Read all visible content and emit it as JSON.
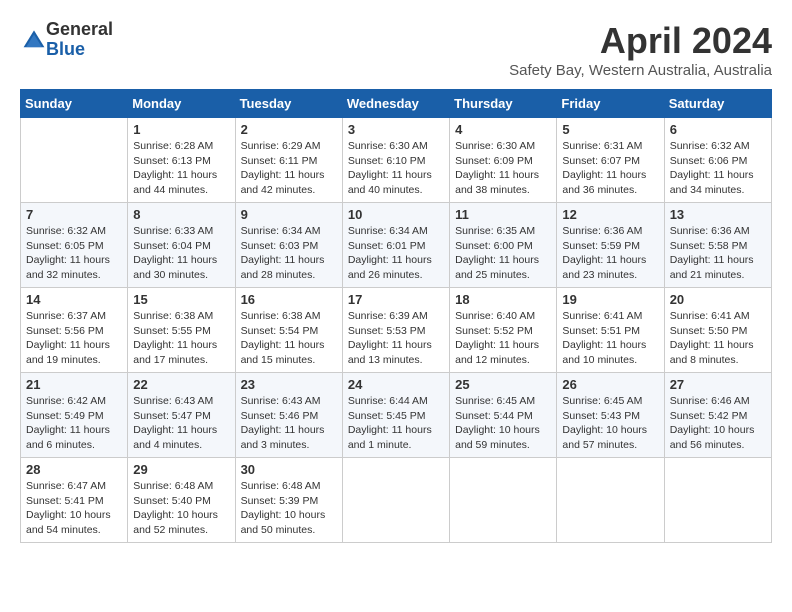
{
  "logo": {
    "general": "General",
    "blue": "Blue"
  },
  "header": {
    "month": "April 2024",
    "location": "Safety Bay, Western Australia, Australia"
  },
  "weekdays": [
    "Sunday",
    "Monday",
    "Tuesday",
    "Wednesday",
    "Thursday",
    "Friday",
    "Saturday"
  ],
  "weeks": [
    [
      {
        "day": "",
        "info": ""
      },
      {
        "day": "1",
        "info": "Sunrise: 6:28 AM\nSunset: 6:13 PM\nDaylight: 11 hours\nand 44 minutes."
      },
      {
        "day": "2",
        "info": "Sunrise: 6:29 AM\nSunset: 6:11 PM\nDaylight: 11 hours\nand 42 minutes."
      },
      {
        "day": "3",
        "info": "Sunrise: 6:30 AM\nSunset: 6:10 PM\nDaylight: 11 hours\nand 40 minutes."
      },
      {
        "day": "4",
        "info": "Sunrise: 6:30 AM\nSunset: 6:09 PM\nDaylight: 11 hours\nand 38 minutes."
      },
      {
        "day": "5",
        "info": "Sunrise: 6:31 AM\nSunset: 6:07 PM\nDaylight: 11 hours\nand 36 minutes."
      },
      {
        "day": "6",
        "info": "Sunrise: 6:32 AM\nSunset: 6:06 PM\nDaylight: 11 hours\nand 34 minutes."
      }
    ],
    [
      {
        "day": "7",
        "info": "Sunrise: 6:32 AM\nSunset: 6:05 PM\nDaylight: 11 hours\nand 32 minutes."
      },
      {
        "day": "8",
        "info": "Sunrise: 6:33 AM\nSunset: 6:04 PM\nDaylight: 11 hours\nand 30 minutes."
      },
      {
        "day": "9",
        "info": "Sunrise: 6:34 AM\nSunset: 6:03 PM\nDaylight: 11 hours\nand 28 minutes."
      },
      {
        "day": "10",
        "info": "Sunrise: 6:34 AM\nSunset: 6:01 PM\nDaylight: 11 hours\nand 26 minutes."
      },
      {
        "day": "11",
        "info": "Sunrise: 6:35 AM\nSunset: 6:00 PM\nDaylight: 11 hours\nand 25 minutes."
      },
      {
        "day": "12",
        "info": "Sunrise: 6:36 AM\nSunset: 5:59 PM\nDaylight: 11 hours\nand 23 minutes."
      },
      {
        "day": "13",
        "info": "Sunrise: 6:36 AM\nSunset: 5:58 PM\nDaylight: 11 hours\nand 21 minutes."
      }
    ],
    [
      {
        "day": "14",
        "info": "Sunrise: 6:37 AM\nSunset: 5:56 PM\nDaylight: 11 hours\nand 19 minutes."
      },
      {
        "day": "15",
        "info": "Sunrise: 6:38 AM\nSunset: 5:55 PM\nDaylight: 11 hours\nand 17 minutes."
      },
      {
        "day": "16",
        "info": "Sunrise: 6:38 AM\nSunset: 5:54 PM\nDaylight: 11 hours\nand 15 minutes."
      },
      {
        "day": "17",
        "info": "Sunrise: 6:39 AM\nSunset: 5:53 PM\nDaylight: 11 hours\nand 13 minutes."
      },
      {
        "day": "18",
        "info": "Sunrise: 6:40 AM\nSunset: 5:52 PM\nDaylight: 11 hours\nand 12 minutes."
      },
      {
        "day": "19",
        "info": "Sunrise: 6:41 AM\nSunset: 5:51 PM\nDaylight: 11 hours\nand 10 minutes."
      },
      {
        "day": "20",
        "info": "Sunrise: 6:41 AM\nSunset: 5:50 PM\nDaylight: 11 hours\nand 8 minutes."
      }
    ],
    [
      {
        "day": "21",
        "info": "Sunrise: 6:42 AM\nSunset: 5:49 PM\nDaylight: 11 hours\nand 6 minutes."
      },
      {
        "day": "22",
        "info": "Sunrise: 6:43 AM\nSunset: 5:47 PM\nDaylight: 11 hours\nand 4 minutes."
      },
      {
        "day": "23",
        "info": "Sunrise: 6:43 AM\nSunset: 5:46 PM\nDaylight: 11 hours\nand 3 minutes."
      },
      {
        "day": "24",
        "info": "Sunrise: 6:44 AM\nSunset: 5:45 PM\nDaylight: 11 hours\nand 1 minute."
      },
      {
        "day": "25",
        "info": "Sunrise: 6:45 AM\nSunset: 5:44 PM\nDaylight: 10 hours\nand 59 minutes."
      },
      {
        "day": "26",
        "info": "Sunrise: 6:45 AM\nSunset: 5:43 PM\nDaylight: 10 hours\nand 57 minutes."
      },
      {
        "day": "27",
        "info": "Sunrise: 6:46 AM\nSunset: 5:42 PM\nDaylight: 10 hours\nand 56 minutes."
      }
    ],
    [
      {
        "day": "28",
        "info": "Sunrise: 6:47 AM\nSunset: 5:41 PM\nDaylight: 10 hours\nand 54 minutes."
      },
      {
        "day": "29",
        "info": "Sunrise: 6:48 AM\nSunset: 5:40 PM\nDaylight: 10 hours\nand 52 minutes."
      },
      {
        "day": "30",
        "info": "Sunrise: 6:48 AM\nSunset: 5:39 PM\nDaylight: 10 hours\nand 50 minutes."
      },
      {
        "day": "",
        "info": ""
      },
      {
        "day": "",
        "info": ""
      },
      {
        "day": "",
        "info": ""
      },
      {
        "day": "",
        "info": ""
      }
    ]
  ]
}
